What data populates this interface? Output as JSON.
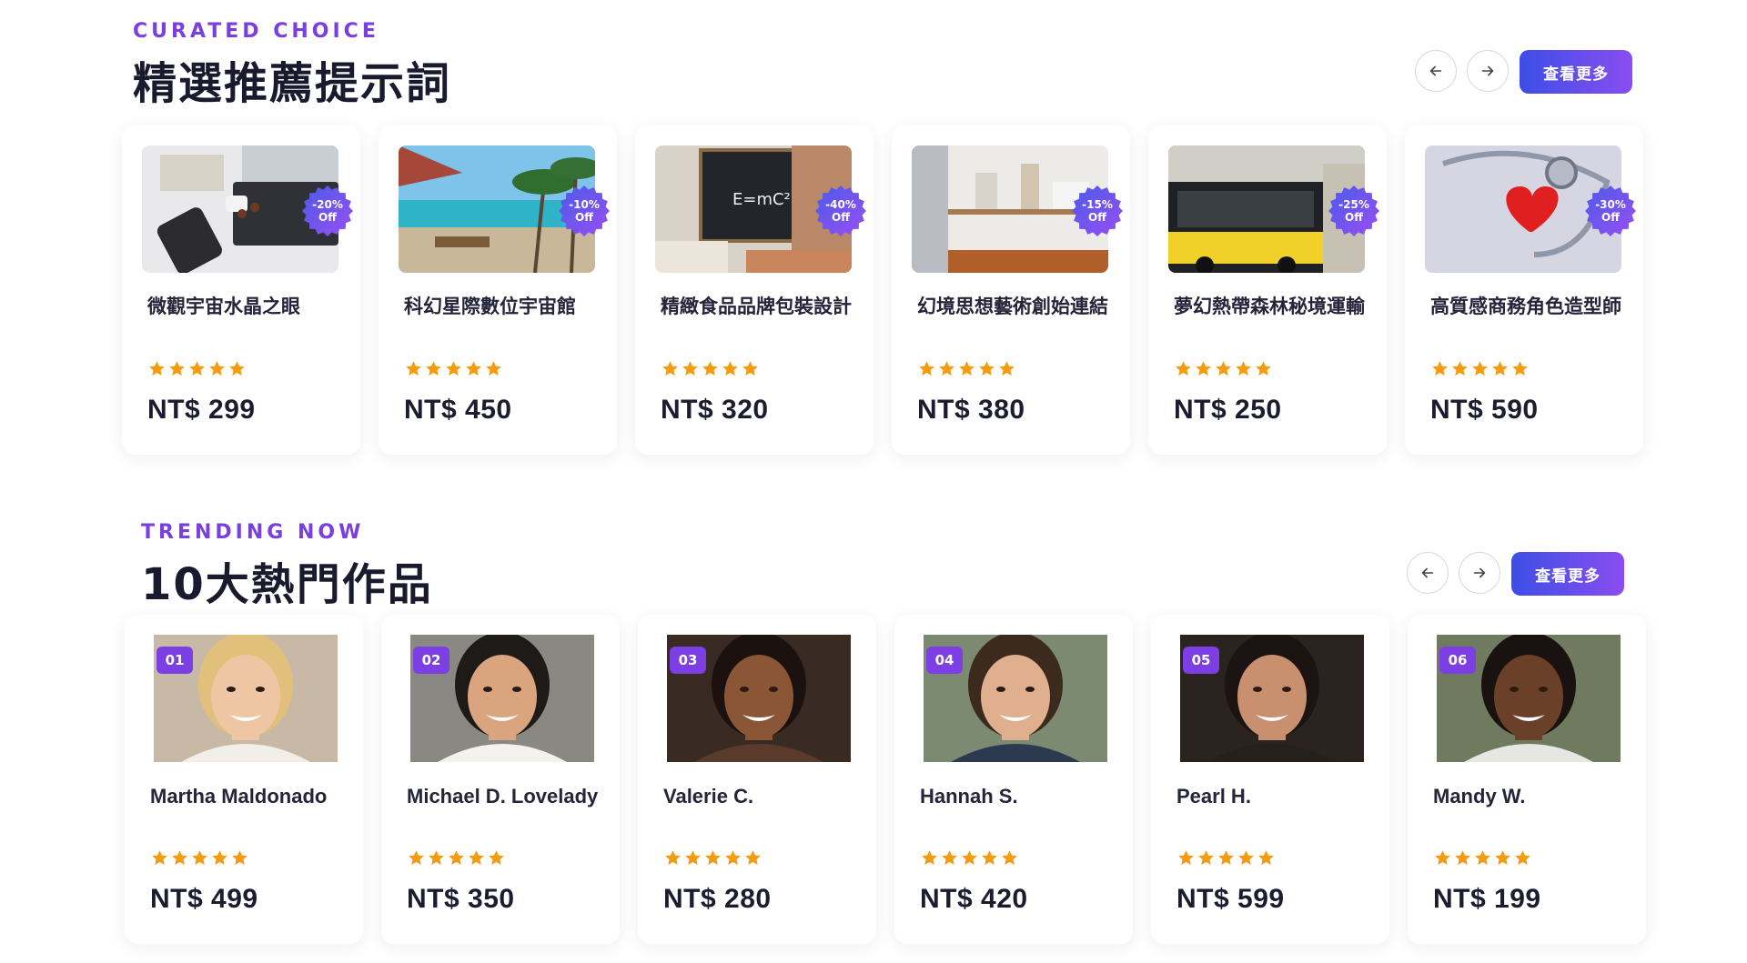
{
  "curated": {
    "eyebrow": "CURATED CHOICE",
    "heading": "精選推薦提示詞",
    "more_label": "查看更多",
    "items": [
      {
        "title": "微觀宇宙水晶之眼",
        "discount": "-20%",
        "off": "Off",
        "price": "NT$ 299",
        "rating": 5,
        "image": "tech-devices-desk"
      },
      {
        "title": "科幻星際數位宇宙館",
        "discount": "-10%",
        "off": "Off",
        "price": "NT$ 450",
        "rating": 5,
        "image": "tropical-beach-resort"
      },
      {
        "title": "精緻食品品牌包裝設計",
        "discount": "-40%",
        "off": "Off",
        "price": "NT$ 320",
        "rating": 5,
        "image": "blackboard-emc2"
      },
      {
        "title": "幻境思想藝術創始連結",
        "discount": "-15%",
        "off": "Off",
        "price": "NT$ 380",
        "rating": 5,
        "image": "shelf-decor"
      },
      {
        "title": "夢幻熱帶森林秘境運輸",
        "discount": "-25%",
        "off": "Off",
        "price": "NT$ 250",
        "rating": 5,
        "image": "yellow-bus"
      },
      {
        "title": "高質感商務角色造型師",
        "discount": "-30%",
        "off": "Off",
        "price": "NT$ 590",
        "rating": 5,
        "image": "stethoscope-heart"
      }
    ]
  },
  "trending": {
    "eyebrow": "TRENDING NOW",
    "heading": "10大熱門作品",
    "more_label": "查看更多",
    "items": [
      {
        "rank": "01",
        "name": "Martha Maldonado",
        "price": "NT$ 499",
        "rating": 5
      },
      {
        "rank": "02",
        "name": "Michael D. Lovelady",
        "price": "NT$ 350",
        "rating": 5
      },
      {
        "rank": "03",
        "name": "Valerie C.",
        "price": "NT$ 280",
        "rating": 5
      },
      {
        "rank": "04",
        "name": "Hannah S.",
        "price": "NT$ 420",
        "rating": 5
      },
      {
        "rank": "05",
        "name": "Pearl H.",
        "price": "NT$ 599",
        "rating": 5
      },
      {
        "rank": "06",
        "name": "Mandy W.",
        "price": "NT$ 199",
        "rating": 5
      }
    ]
  },
  "colors": {
    "accent": "#7a3fe0",
    "button_start": "#3d4ee6",
    "button_end": "#8a4df0",
    "star": "#f39c12"
  },
  "icons": {
    "prev": "arrow-left-icon",
    "next": "arrow-right-icon",
    "star": "star-icon",
    "badge": "discount-badge-icon"
  }
}
